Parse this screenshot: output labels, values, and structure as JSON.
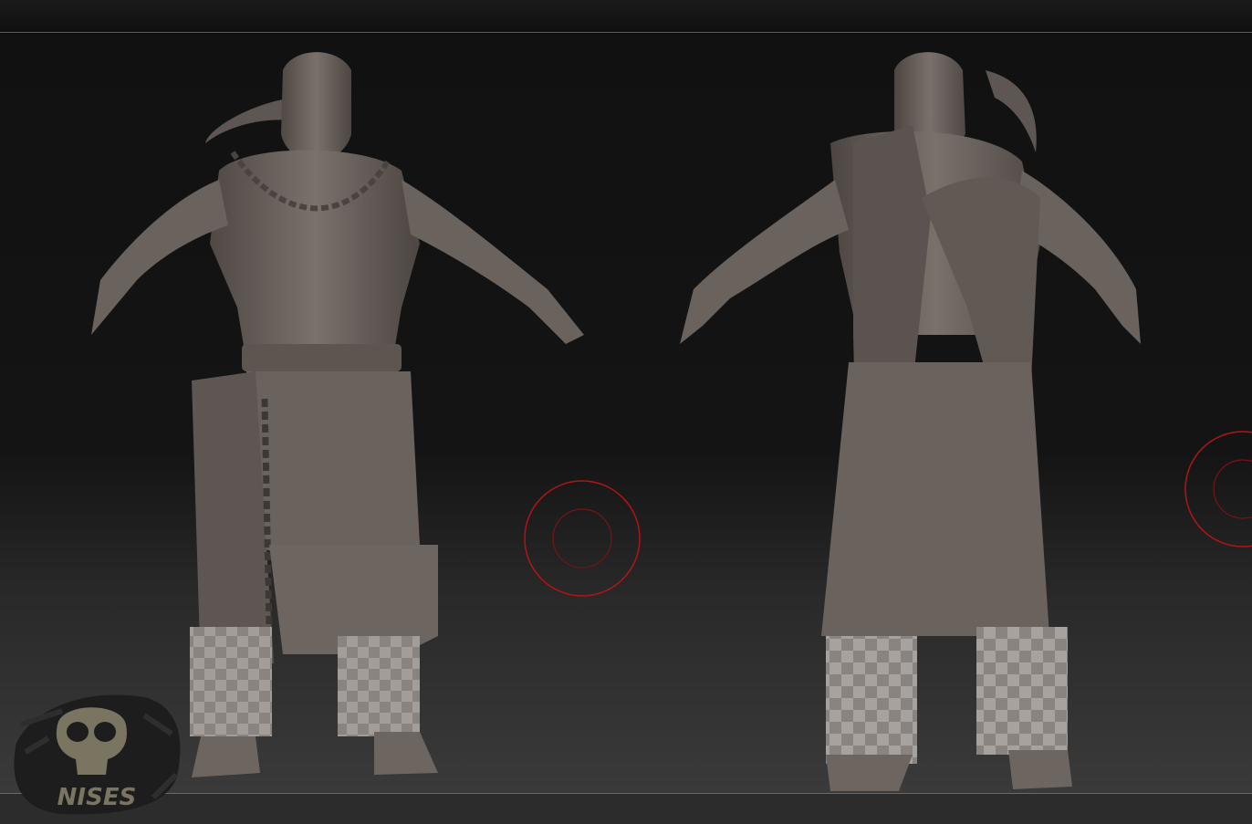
{
  "window": {
    "title": ""
  },
  "viewport": {
    "models": [
      {
        "name": "front-view",
        "view": "front"
      },
      {
        "name": "back-view",
        "view": "back"
      }
    ],
    "cursor_color": "#b01515"
  },
  "watermark": {
    "text": "NISES",
    "color": "#7a7560"
  },
  "colors": {
    "clay": "#6f6762",
    "clay_dark": "#4a4340",
    "background": "#111111"
  }
}
